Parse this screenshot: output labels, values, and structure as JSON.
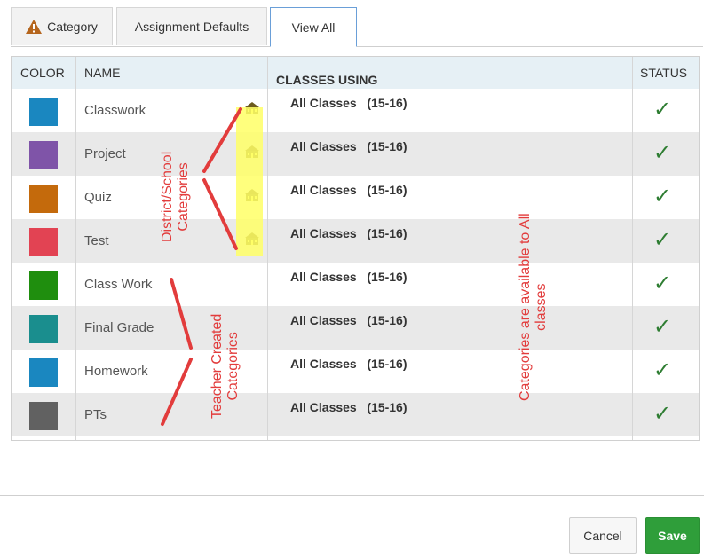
{
  "tabs": [
    {
      "label": "Category"
    },
    {
      "label": "Assignment Defaults"
    },
    {
      "label": "View All"
    }
  ],
  "table": {
    "headers": {
      "color": "COLOR",
      "name": "NAME",
      "classes": "CLASSES USING",
      "status": "STATUS"
    },
    "rows": [
      {
        "color": "#1a87c0",
        "name": "Classwork",
        "classes": "All Classes   (15-16)",
        "school_icon": true
      },
      {
        "color": "#7f54a8",
        "name": "Project",
        "classes": "All Classes   (15-16)",
        "school_icon": true
      },
      {
        "color": "#c46a0c",
        "name": "Quiz",
        "classes": "All Classes   (15-16)",
        "school_icon": true
      },
      {
        "color": "#e24353",
        "name": "Test",
        "classes": "All Classes   (15-16)",
        "school_icon": true
      },
      {
        "color": "#1f8e0e",
        "name": "Class Work",
        "classes": "All Classes   (15-16)",
        "school_icon": false
      },
      {
        "color": "#1a8e8e",
        "name": "Final Grade",
        "classes": "All Classes   (15-16)",
        "school_icon": false
      },
      {
        "color": "#1a87c0",
        "name": "Homework",
        "classes": "All Classes   (15-16)",
        "school_icon": false
      },
      {
        "color": "#616161",
        "name": "PTs",
        "classes": "All Classes   (15-16)",
        "school_icon": false
      }
    ],
    "status_icon": "check-icon"
  },
  "annotations": {
    "district": [
      "District/School",
      "Categories"
    ],
    "teacher": [
      "Teacher Created",
      "Categories"
    ],
    "available": [
      "Categories are available to All",
      "classes"
    ]
  },
  "buttons": {
    "cancel": "Cancel",
    "save": "Save"
  },
  "colors": {
    "annotation": "#e23c3c",
    "highlight": "#ffff66",
    "save": "#2f9e3a",
    "check": "#2e7d32",
    "tab_active_border": "#6a9fd8"
  }
}
